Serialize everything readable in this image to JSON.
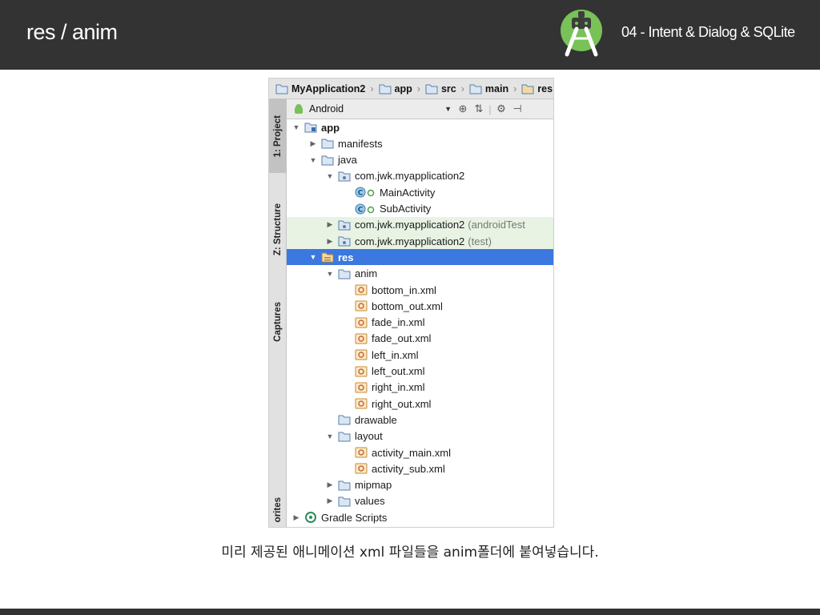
{
  "slide": {
    "title": "res / anim",
    "chapter": "04 - Intent & Dialog & SQLite",
    "caption": "미리 제공된 애니메이션 xml 파일들을 anim폴더에 붙여넣습니다."
  },
  "breadcrumb": [
    {
      "label": "MyApplication2"
    },
    {
      "label": "app"
    },
    {
      "label": "src"
    },
    {
      "label": "main"
    },
    {
      "label": "res"
    }
  ],
  "side_tabs": {
    "project": "1: Project",
    "structure": "Z: Structure",
    "captures": "Captures",
    "favorites": "orites"
  },
  "toolbar": {
    "view_mode": "Android"
  },
  "tree": [
    {
      "label": "app",
      "extra": "",
      "indent": 0,
      "twisty": "down",
      "icon": "module",
      "state": "",
      "bold": true
    },
    {
      "label": "manifests",
      "extra": "",
      "indent": 1,
      "twisty": "right",
      "icon": "folder",
      "state": ""
    },
    {
      "label": "java",
      "extra": "",
      "indent": 1,
      "twisty": "down",
      "icon": "folder",
      "state": ""
    },
    {
      "label": "com.jwk.myapplication2",
      "extra": "",
      "indent": 2,
      "twisty": "down",
      "icon": "package",
      "state": ""
    },
    {
      "label": "MainActivity",
      "extra": "",
      "indent": 3,
      "twisty": "",
      "icon": "class",
      "state": ""
    },
    {
      "label": "SubActivity",
      "extra": "",
      "indent": 3,
      "twisty": "",
      "icon": "class",
      "state": ""
    },
    {
      "label": "com.jwk.myapplication2",
      "extra": "(androidTest",
      "indent": 2,
      "twisty": "right",
      "icon": "package",
      "state": "hl"
    },
    {
      "label": "com.jwk.myapplication2",
      "extra": "(test)",
      "indent": 2,
      "twisty": "right",
      "icon": "package",
      "state": "hl"
    },
    {
      "label": "res",
      "extra": "",
      "indent": 1,
      "twisty": "down",
      "icon": "resfolder",
      "state": "sel",
      "bold": true
    },
    {
      "label": "anim",
      "extra": "",
      "indent": 2,
      "twisty": "down",
      "icon": "folder",
      "state": ""
    },
    {
      "label": "bottom_in.xml",
      "extra": "",
      "indent": 3,
      "twisty": "",
      "icon": "xml",
      "state": ""
    },
    {
      "label": "bottom_out.xml",
      "extra": "",
      "indent": 3,
      "twisty": "",
      "icon": "xml",
      "state": ""
    },
    {
      "label": "fade_in.xml",
      "extra": "",
      "indent": 3,
      "twisty": "",
      "icon": "xml",
      "state": ""
    },
    {
      "label": "fade_out.xml",
      "extra": "",
      "indent": 3,
      "twisty": "",
      "icon": "xml",
      "state": ""
    },
    {
      "label": "left_in.xml",
      "extra": "",
      "indent": 3,
      "twisty": "",
      "icon": "xml",
      "state": ""
    },
    {
      "label": "left_out.xml",
      "extra": "",
      "indent": 3,
      "twisty": "",
      "icon": "xml",
      "state": ""
    },
    {
      "label": "right_in.xml",
      "extra": "",
      "indent": 3,
      "twisty": "",
      "icon": "xml",
      "state": ""
    },
    {
      "label": "right_out.xml",
      "extra": "",
      "indent": 3,
      "twisty": "",
      "icon": "xml",
      "state": ""
    },
    {
      "label": "drawable",
      "extra": "",
      "indent": 2,
      "twisty": "",
      "icon": "folder",
      "state": ""
    },
    {
      "label": "layout",
      "extra": "",
      "indent": 2,
      "twisty": "down",
      "icon": "folder",
      "state": ""
    },
    {
      "label": "activity_main.xml",
      "extra": "",
      "indent": 3,
      "twisty": "",
      "icon": "xml",
      "state": ""
    },
    {
      "label": "activity_sub.xml",
      "extra": "",
      "indent": 3,
      "twisty": "",
      "icon": "xml",
      "state": ""
    },
    {
      "label": "mipmap",
      "extra": "",
      "indent": 2,
      "twisty": "right",
      "icon": "folder",
      "state": ""
    },
    {
      "label": "values",
      "extra": "",
      "indent": 2,
      "twisty": "right",
      "icon": "folder",
      "state": ""
    },
    {
      "label": "Gradle Scripts",
      "extra": "",
      "indent": 0,
      "twisty": "right",
      "icon": "gradle",
      "state": ""
    }
  ],
  "colors": {
    "header_bg": "#333333",
    "selection": "#3b78e0",
    "highlight_row": "#e8f3e3",
    "android_green": "#78c257"
  }
}
